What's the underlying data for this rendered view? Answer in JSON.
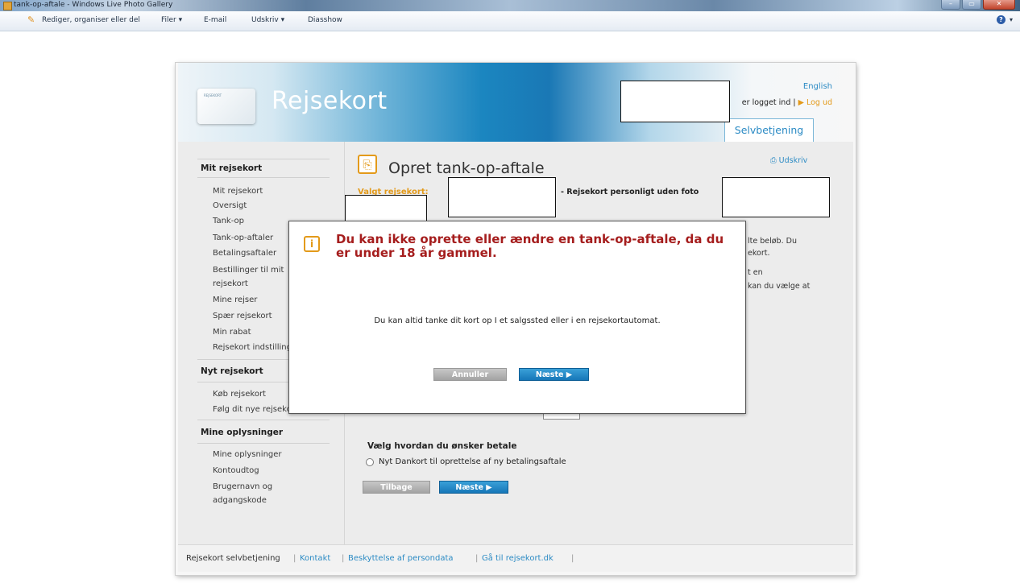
{
  "window": {
    "title": "tank-op-aftale - Windows Live Photo Gallery",
    "buttons": {
      "minimize": "–",
      "maximize": "▭",
      "close": "✕"
    }
  },
  "toolbar": {
    "items": [
      "Rediger, organiser eller del",
      "Filer ▾",
      "E-mail",
      "Udskriv ▾",
      "Diasshow"
    ],
    "help": "?"
  },
  "site": {
    "brand": "Rejsekort",
    "card_text": "REJSEKORT",
    "language_link": "English",
    "logged_in_text": "er logget ind | ",
    "logout_link": "Log ud",
    "tab": "Selvbetjening"
  },
  "sidebar": {
    "sections": [
      {
        "heading": "Mit rejsekort",
        "items": [
          "Mit rejsekort",
          "Oversigt",
          "Tank-op",
          "Tank-op-aftaler",
          "Betalingsaftaler",
          "Bestillinger til mit",
          "rejsekort",
          "Mine rejser",
          "Spær rejsekort",
          "Min rabat",
          "Rejsekort indstillinger"
        ]
      },
      {
        "heading": "Nyt rejsekort",
        "items": [
          "Køb rejsekort",
          "Følg dit nye rejsekort"
        ]
      },
      {
        "heading": "Mine oplysninger",
        "items": [
          "Mine oplysninger",
          "Kontoudtog",
          "Brugernavn og",
          "adgangskode"
        ]
      }
    ]
  },
  "content": {
    "title": "Opret tank-op-aftale",
    "print_link": "Udskriv",
    "selected_label": "Valgt rejsekort:",
    "card_type": "- Rejsekort personligt uden foto",
    "bg_text": [
      "lte beløb. Du",
      "ekort.",
      "t en",
      "kan du vælge at"
    ],
    "payment_heading": "Vælg hvordan du ønsker betale",
    "payment_option": "Nyt Dankort til oprettelse af ny betalingsaftale",
    "back_button": "Tilbage",
    "next_button": "Næste ▶"
  },
  "modal": {
    "title": "Du kan ikke oprette eller ændre en tank-op-aftale, da du er under 18 år gammel.",
    "body": "Du kan altid tanke dit kort op I et salgssted eller i en rejsekortautomat.",
    "cancel_button": "Annuller",
    "next_button": "Næste ▶"
  },
  "footer": {
    "items": [
      "Rejsekort selvbetjening",
      "Kontakt",
      "Beskyttelse af persondata",
      "Gå til rejsekort.dk"
    ]
  }
}
